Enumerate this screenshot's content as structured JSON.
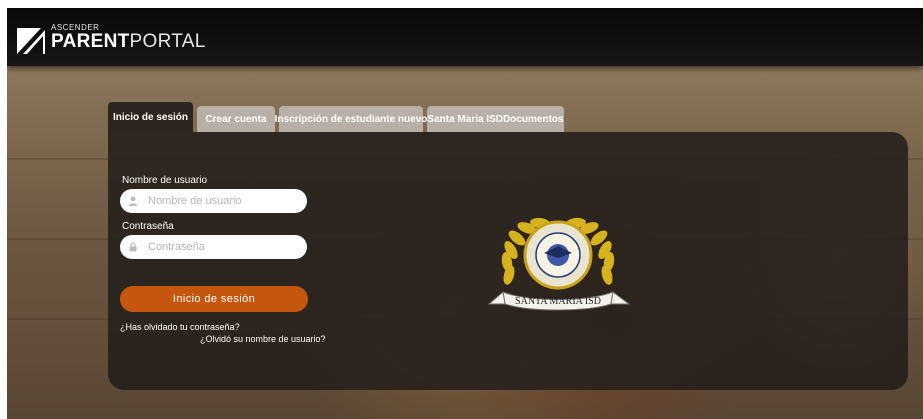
{
  "header": {
    "logo_small": "ASCENDER",
    "logo_bold": "PARENT",
    "logo_light": "PORTAL"
  },
  "tabs": [
    {
      "label": "Inicio de sesión",
      "active": true
    },
    {
      "label": "Crear cuenta",
      "active": false
    },
    {
      "label": "Inscripción de estudiante nuevo",
      "active": false
    },
    {
      "label": "Santa Maria ISDDocumentos",
      "active": false
    }
  ],
  "form": {
    "username_label": "Nombre de usuario",
    "username_placeholder": "Nombre de usuario",
    "username_value": "",
    "password_label": "Contraseña",
    "password_placeholder": "Contraseña",
    "password_value": "",
    "submit_label": "Inicio de sesión",
    "forgot_password": "¿Has olvidado tu contraseña?",
    "forgot_username": "¿Olvidó su nombre de usuario?"
  },
  "seal": {
    "banner_text": "SANTA MARIA ISD"
  },
  "colors": {
    "accent": "#c5560e",
    "panel": "#26201c",
    "tab_inactive": "#b8b0a6",
    "header": "#0b0b0b"
  },
  "icons": {
    "username": "user-icon",
    "password": "lock-icon"
  }
}
